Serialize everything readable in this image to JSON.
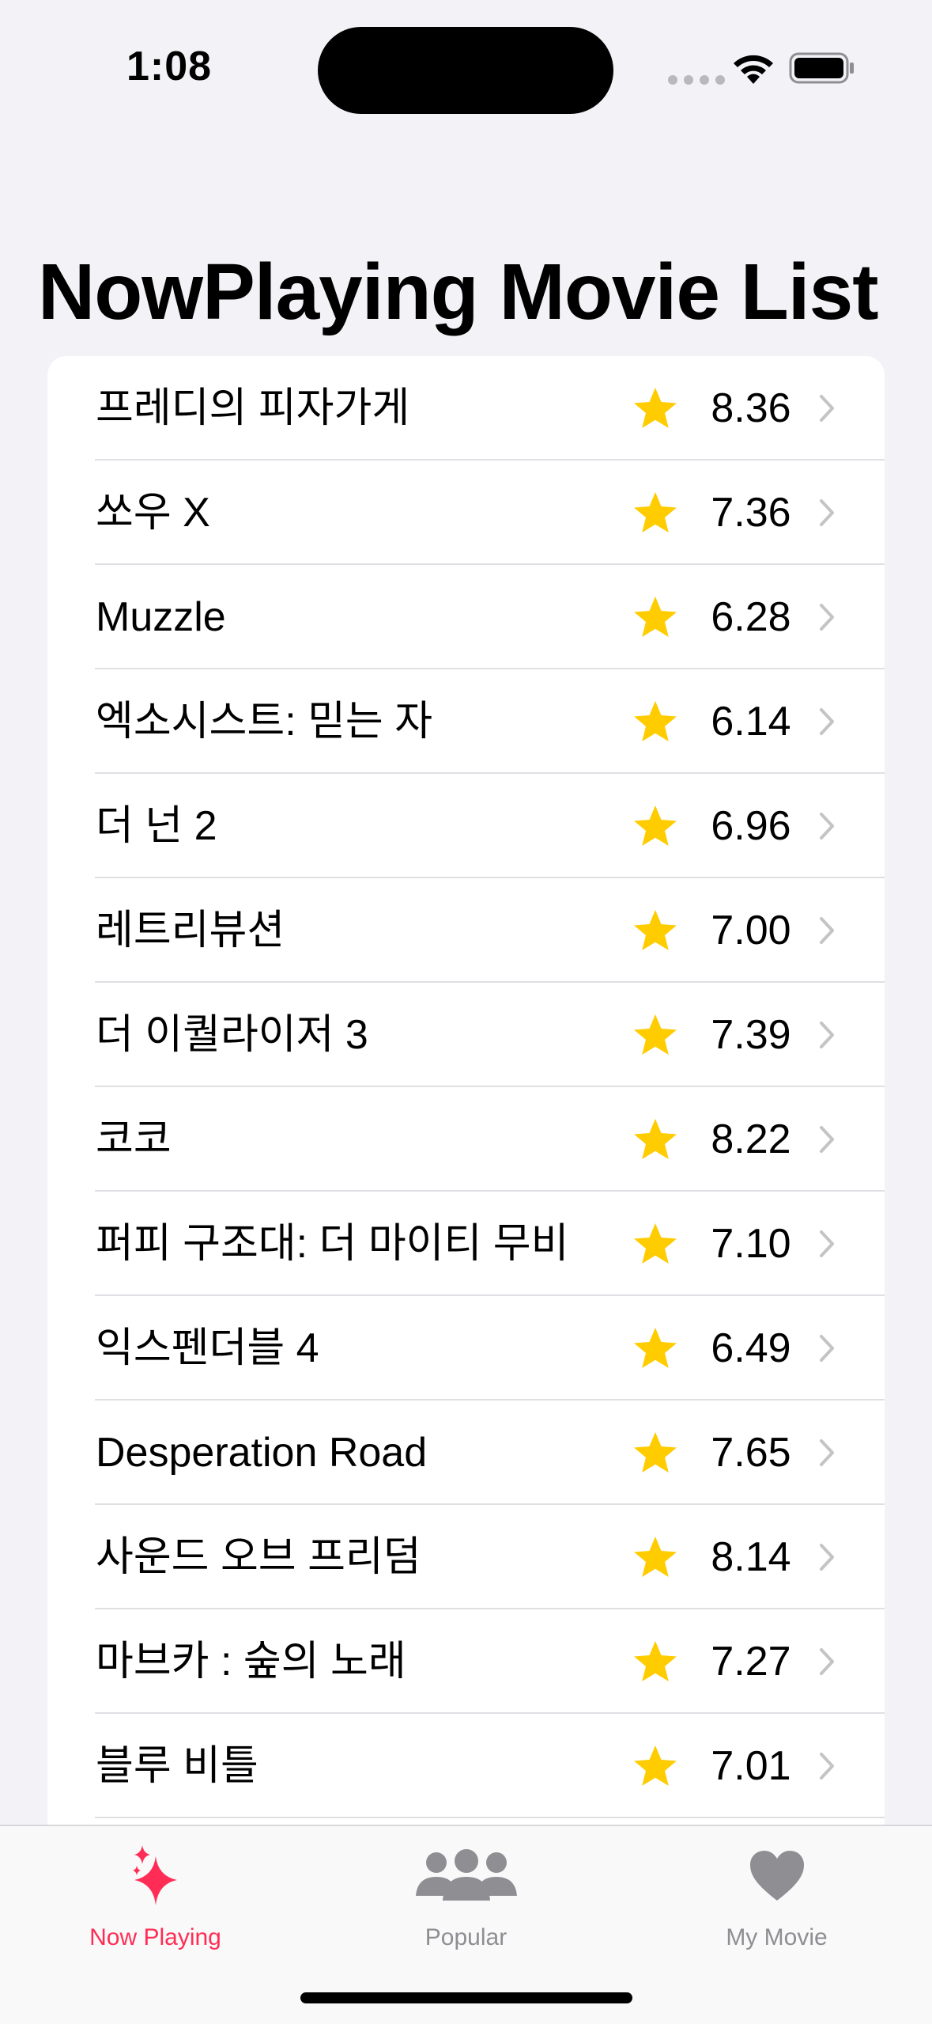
{
  "status_bar": {
    "time": "1:08"
  },
  "page": {
    "title": "NowPlaying Movie List"
  },
  "movies": [
    {
      "title": "프레디의 피자가게",
      "rating": "8.36"
    },
    {
      "title": "쏘우 X",
      "rating": "7.36"
    },
    {
      "title": "Muzzle",
      "rating": "6.28"
    },
    {
      "title": "엑소시스트: 믿는 자",
      "rating": "6.14"
    },
    {
      "title": "더 넌 2",
      "rating": "6.96"
    },
    {
      "title": "레트리뷰션",
      "rating": "7.00"
    },
    {
      "title": "더 이퀄라이저 3",
      "rating": "7.39"
    },
    {
      "title": "코코",
      "rating": "8.22"
    },
    {
      "title": "퍼피 구조대: 더 마이티 무비",
      "rating": "7.10"
    },
    {
      "title": "익스펜더블 4",
      "rating": "6.49"
    },
    {
      "title": "Desperation Road",
      "rating": "7.65"
    },
    {
      "title": "사운드 오브 프리덤",
      "rating": "8.14"
    },
    {
      "title": "마브카 : 숲의 노래",
      "rating": "7.27"
    },
    {
      "title": "블루 비틀",
      "rating": "7.01"
    }
  ],
  "tab_bar": {
    "tabs": [
      {
        "label": "Now Playing",
        "icon": "sparkles-icon",
        "selected": true
      },
      {
        "label": "Popular",
        "icon": "people-icon",
        "selected": false
      },
      {
        "label": "My Movie",
        "icon": "heart-icon",
        "selected": false
      }
    ]
  },
  "colors": {
    "accent": "#ff2d55",
    "star": "#ffcc00",
    "tab_inactive": "#8e8e93",
    "background": "#f2f2f7"
  }
}
